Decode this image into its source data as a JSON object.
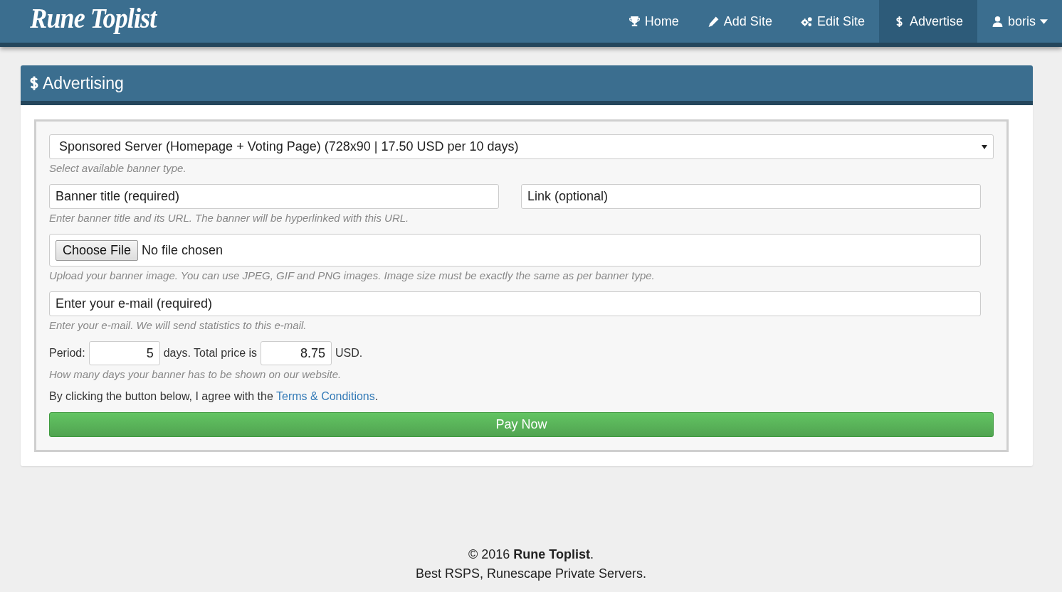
{
  "brand": "Rune Toplist",
  "nav": [
    {
      "label": "Home",
      "kind": "trophy",
      "selected": false
    },
    {
      "label": "Add Site",
      "kind": "pencil",
      "selected": false
    },
    {
      "label": "Edit Site",
      "kind": "cogs",
      "selected": false
    },
    {
      "label": "Advertise",
      "kind": "dollar",
      "selected": true
    },
    {
      "label": "boris",
      "kind": "user",
      "selected": false,
      "dropdown": true
    }
  ],
  "panel": {
    "title": "Advertising"
  },
  "form": {
    "banner_type": {
      "value": "Sponsored Server (Homepage + Voting Page) (728x90 | 17.50 USD per 10 days)",
      "help": "Select available banner type."
    },
    "title_field": {
      "placeholder": "Banner title (required)"
    },
    "link_field": {
      "placeholder": "Link (optional)"
    },
    "title_help": "Enter banner title and its URL. The banner will be hyperlinked with this URL.",
    "file": {
      "button": "Choose File",
      "status": "No file chosen",
      "help": "Upload your banner image. You can use JPEG, GIF and PNG images. Image size must be exactly the same as per banner type."
    },
    "email": {
      "placeholder": "Enter your e-mail (required)",
      "help": "Enter your e-mail. We will send statistics to this e-mail."
    },
    "period": {
      "label": "Period:",
      "value": "5",
      "middle": "days. Total price is",
      "price": "8.75",
      "unit": "USD.",
      "help": "How many days your banner has to be shown on our website."
    },
    "agree": {
      "text": "By clicking the button below, I agree with the ",
      "link": "Terms & Conditions",
      "end": "."
    },
    "submit": "Pay Now"
  },
  "footer": {
    "copyright": "© 2016 **Rune Toplist**.",
    "tagline": "Best RSPS, Runescape Private Servers."
  }
}
